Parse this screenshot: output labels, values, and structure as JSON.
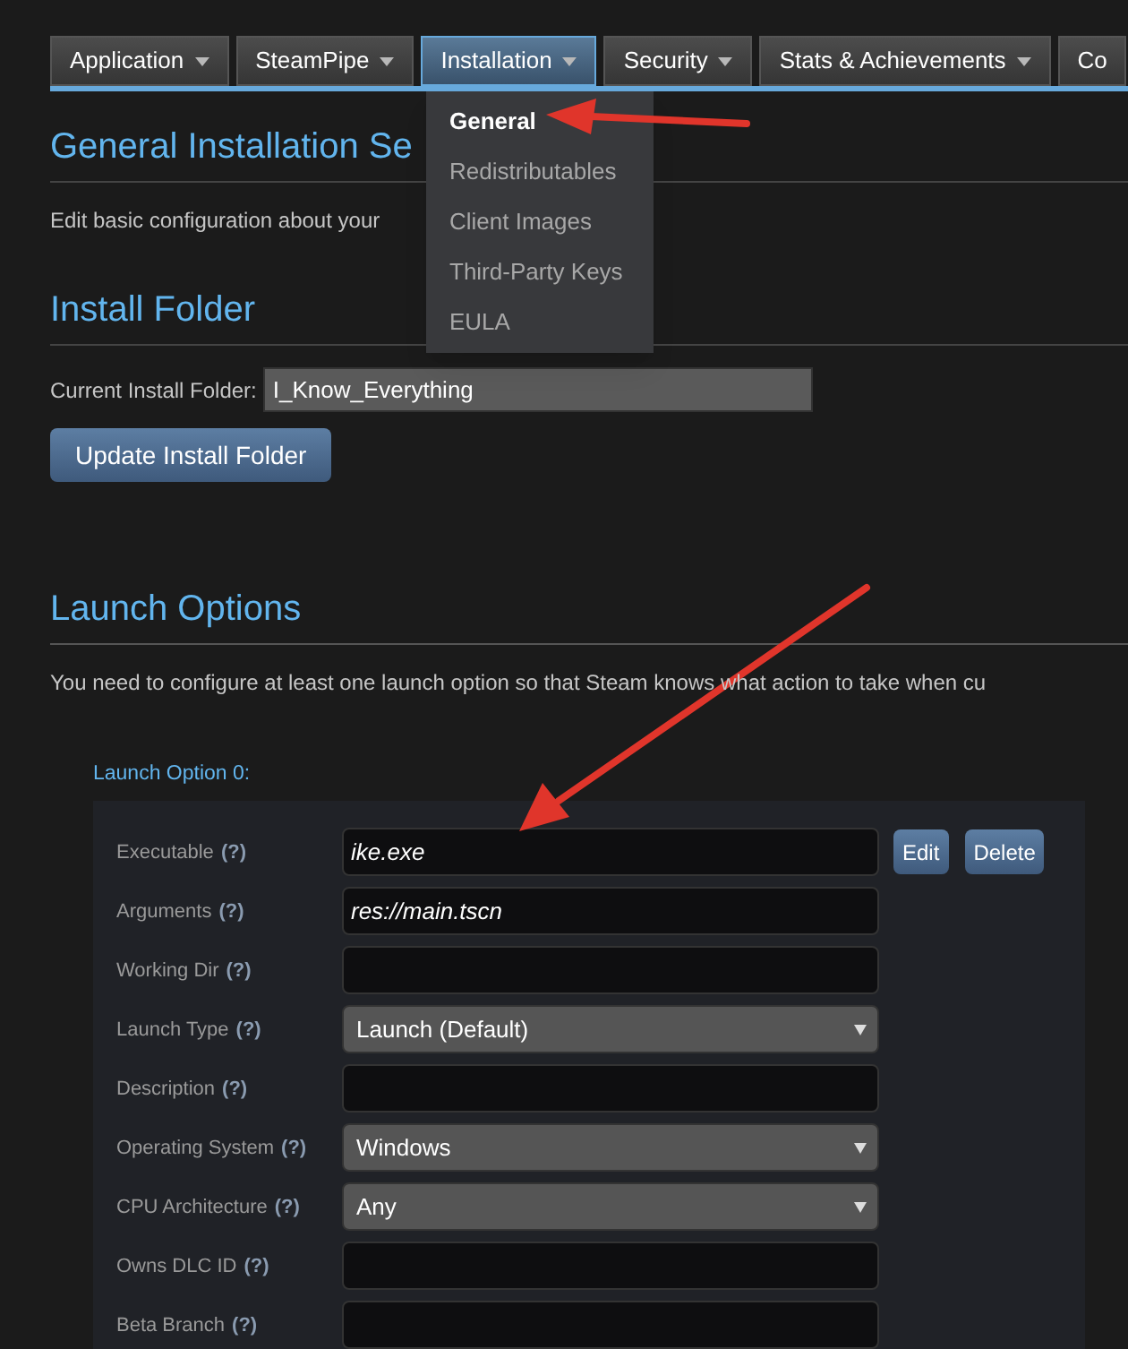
{
  "tabs": [
    {
      "label": "Application",
      "selected": false
    },
    {
      "label": "SteamPipe",
      "selected": false
    },
    {
      "label": "Installation",
      "selected": true
    },
    {
      "label": "Security",
      "selected": false
    },
    {
      "label": "Stats & Achievements",
      "selected": false
    },
    {
      "label": "Co",
      "selected": false
    }
  ],
  "dropdown_menu": [
    {
      "label": "General",
      "selected": true
    },
    {
      "label": "Redistributables",
      "selected": false
    },
    {
      "label": "Client Images",
      "selected": false
    },
    {
      "label": "Third-Party Keys",
      "selected": false
    },
    {
      "label": "EULA",
      "selected": false
    }
  ],
  "general_section": {
    "title": "General Installation Se",
    "description": "Edit basic configuration about your"
  },
  "install_folder": {
    "title": "Install Folder",
    "label": "Current Install Folder:",
    "value": "I_Know_Everything",
    "button": "Update Install Folder"
  },
  "launch_options": {
    "title": "Launch Options",
    "description": "You need to configure at least one launch option so that Steam knows what action to take when cu",
    "option_title": "Launch Option 0:",
    "rows": [
      {
        "label": "Executable",
        "help": "(?)",
        "kind": "input",
        "value": "ike.exe",
        "buttons": [
          "Edit",
          "Delete"
        ]
      },
      {
        "label": "Arguments",
        "help": "(?)",
        "kind": "input",
        "value": "res://main.tscn"
      },
      {
        "label": "Working Dir",
        "help": "(?)",
        "kind": "input"
      },
      {
        "label": "Launch Type",
        "help": "(?)",
        "kind": "select",
        "value": "Launch (Default)"
      },
      {
        "label": "Description",
        "help": "(?)",
        "kind": "input"
      },
      {
        "label": "Operating System",
        "help": "(?)",
        "kind": "select",
        "value": "Windows"
      },
      {
        "label": "CPU Architecture",
        "help": "(?)",
        "kind": "select",
        "value": "Any"
      },
      {
        "label": "Owns DLC ID",
        "help": "(?)",
        "kind": "input"
      },
      {
        "label": "Beta Branch",
        "help": "(?)",
        "kind": "input"
      }
    ]
  }
}
